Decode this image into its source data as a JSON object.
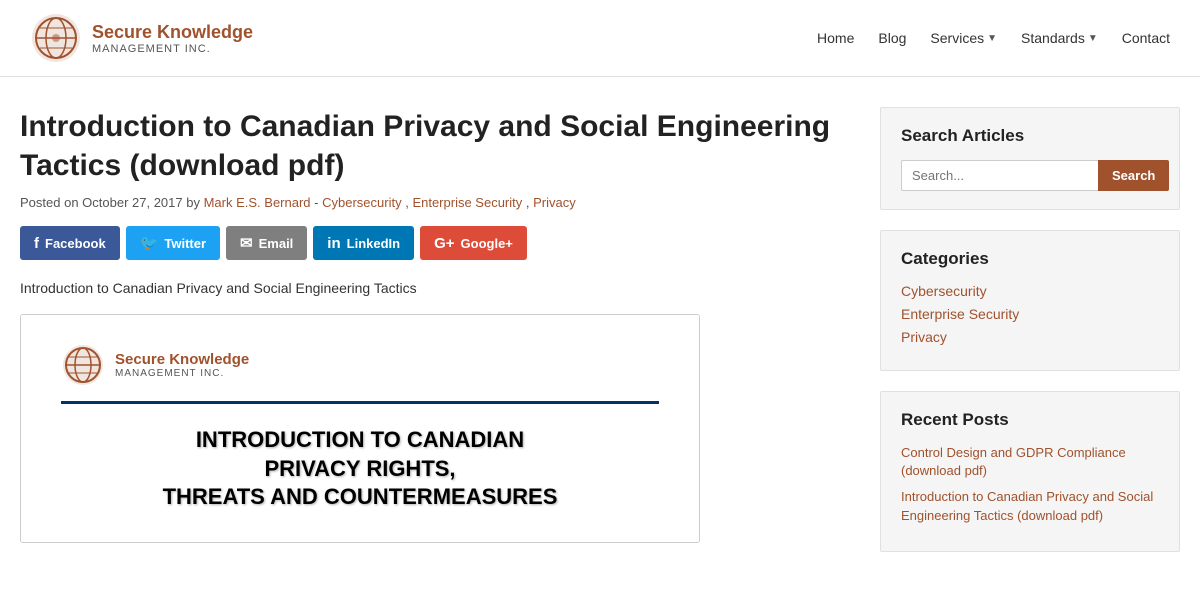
{
  "header": {
    "logo_title": "Secure Knowledge",
    "logo_subtitle": "Management Inc.",
    "nav": {
      "home": "Home",
      "blog": "Blog",
      "services": "Services",
      "standards": "Standards",
      "contact": "Contact"
    }
  },
  "article": {
    "title": "Introduction to Canadian Privacy and Social Engineering Tactics (download pdf)",
    "meta": {
      "prefix": "Posted on ",
      "date": "October 27, 2017",
      "by": " by ",
      "author": "Mark E.S. Bernard",
      "separator1": " - ",
      "cat1": "Cybersecurity",
      "separator2": ", ",
      "cat2": "Enterprise Security",
      "separator3": ", ",
      "cat3": "Privacy"
    },
    "caption": "Introduction to Canadian Privacy and Social Engineering Tactics",
    "social_buttons": [
      {
        "id": "facebook",
        "icon": "f",
        "label": "Facebook"
      },
      {
        "id": "twitter",
        "icon": "t",
        "label": "Twitter"
      },
      {
        "id": "email",
        "icon": "✉",
        "label": "Email"
      },
      {
        "id": "linkedin",
        "icon": "in",
        "label": "LinkedIn"
      },
      {
        "id": "googleplus",
        "icon": "G+",
        "label": "Google+"
      }
    ]
  },
  "pdf_preview": {
    "logo_title": "Secure Knowledge",
    "logo_subtitle": "Management Inc.",
    "main_title": "INTRODUCTION TO CANADIAN\nPRIVACY RIGHTS,\nTHREATS AND COUNTERMEASURES",
    "line1": "INTRODUCTION TO CANADIAN",
    "line2": "PRIVACY RIGHTS,",
    "line3": "THREATS AND COUNTERMEASURES"
  },
  "sidebar": {
    "search": {
      "title": "Search Articles",
      "placeholder": "Search...",
      "button": "Search"
    },
    "categories": {
      "title": "Categories",
      "items": [
        "Cybersecurity",
        "Enterprise Security",
        "Privacy"
      ]
    },
    "recent_posts": {
      "title": "Recent Posts",
      "items": [
        "Control Design and GDPR Compliance (download pdf)",
        "Introduction to Canadian Privacy and Social Engineering Tactics (download pdf)"
      ]
    }
  }
}
